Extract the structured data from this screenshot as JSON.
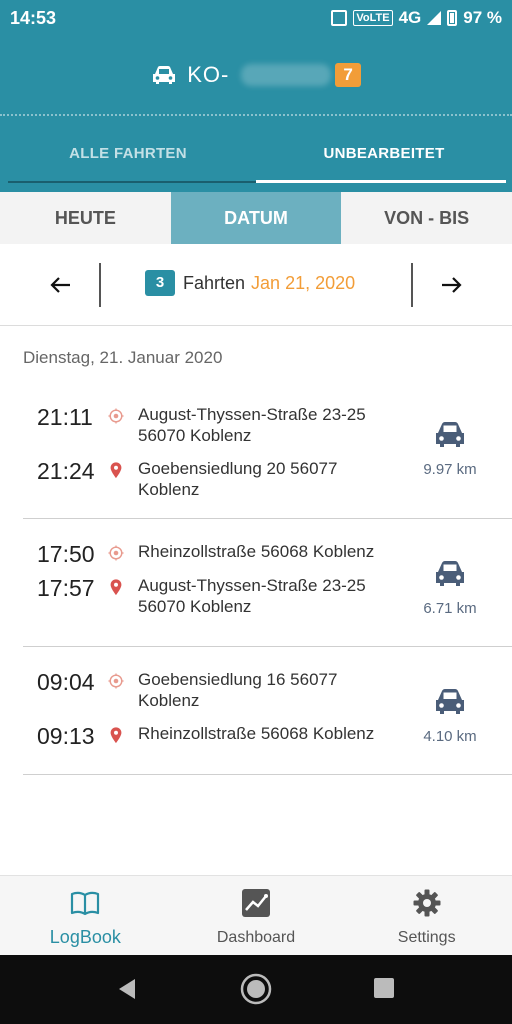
{
  "status_bar": {
    "time": "14:53",
    "network": "4G",
    "volte": "VoLTE",
    "battery": "97 %"
  },
  "vehicle": {
    "plate_prefix": "KO-",
    "badge": "7",
    "icon": "car-icon"
  },
  "tabs": [
    {
      "label": "ALLE FAHRTEN",
      "active": false
    },
    {
      "label": "UNBEARBEITET",
      "active": true
    }
  ],
  "segments": [
    {
      "label": "HEUTE",
      "active": false
    },
    {
      "label": "DATUM",
      "active": true
    },
    {
      "label": "VON - BIS",
      "active": false
    }
  ],
  "date_nav": {
    "count": "3",
    "label": "Fahrten",
    "date": "Jan 21, 2020"
  },
  "day_header": "Dienstag, 21. Januar 2020",
  "trips": [
    {
      "start_time": "21:11",
      "start_address": "August-Thyssen-Straße 23-25 56070 Koblenz",
      "end_time": "21:24",
      "end_address": "Goebensiedlung 20 56077 Koblenz",
      "distance": "9.97 km"
    },
    {
      "start_time": "17:50",
      "start_address": "Rheinzollstraße 56068 Koblenz",
      "end_time": "17:57",
      "end_address": "August-Thyssen-Straße 23-25 56070 Koblenz",
      "distance": "6.71 km"
    },
    {
      "start_time": "09:04",
      "start_address": "Goebensiedlung 16 56077 Koblenz",
      "end_time": "09:13",
      "end_address": "Rheinzollstraße 56068 Koblenz",
      "distance": "4.10 km"
    }
  ],
  "bottom_nav": [
    {
      "label": "LogBook",
      "icon": "book-icon",
      "active": true
    },
    {
      "label": "Dashboard",
      "icon": "chart-icon",
      "active": false
    },
    {
      "label": "Settings",
      "icon": "gear-icon",
      "active": false
    }
  ],
  "colors": {
    "primary": "#2a8fa4",
    "accent": "#f29d38",
    "segment_active": "#6cb0c0",
    "start_marker": "#e89a8e",
    "end_marker": "#d9534f",
    "car": "#4a5d78"
  }
}
